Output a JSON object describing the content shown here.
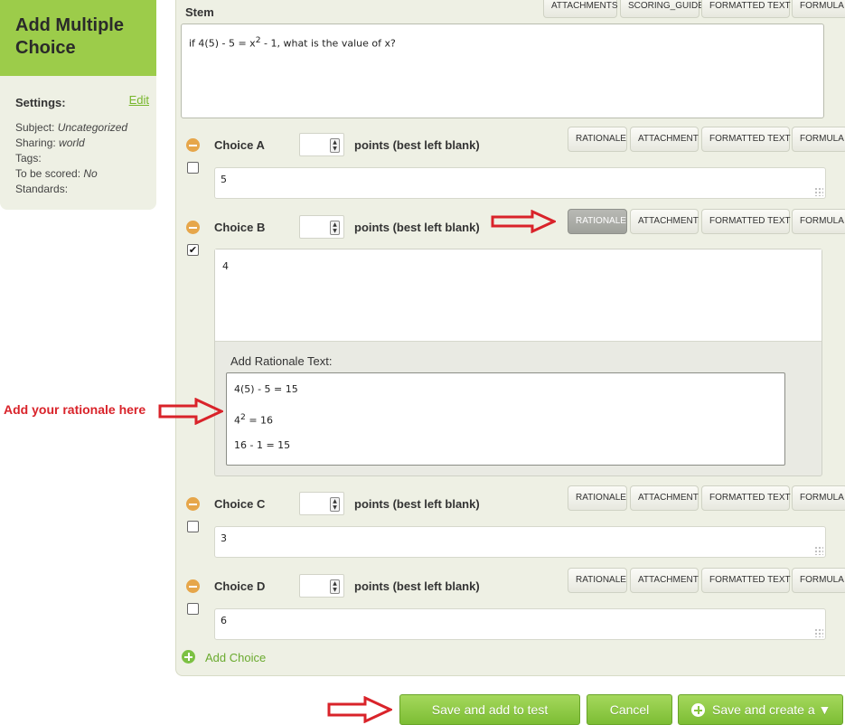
{
  "sidebar": {
    "title": "Add Multiple Choice",
    "settings_label": "Settings:",
    "edit_label": "Edit",
    "subject_label": "Subject:",
    "subject_value": "Uncategorized",
    "sharing_label": "Sharing:",
    "sharing_value": "world",
    "tags_label": "Tags:",
    "scored_label": "To be scored:",
    "scored_value": "No",
    "standards_label": "Standards:"
  },
  "stem": {
    "label": "Stem",
    "text_before": "if 4(5) - 5 = x",
    "text_sup": "2",
    "text_after": " - 1, what is the value of x?",
    "buttons": [
      "ATTACHMENTS",
      "SCORING_GUIDE",
      "FORMATTED TEXT",
      "FORMULA"
    ]
  },
  "choice_buttons": {
    "rationale": "RATIONALE",
    "attachment": "ATTACHMENT",
    "formatted_text": "FORMATTED TEXT",
    "formula": "FORMULA"
  },
  "points_label": "points (best left blank)",
  "choices": [
    {
      "label": "Choice A",
      "answer": "5",
      "checked": false
    },
    {
      "label": "Choice B",
      "answer": "4",
      "checked": true
    },
    {
      "label": "Choice C",
      "answer": "3",
      "checked": false
    },
    {
      "label": "Choice D",
      "answer": "6",
      "checked": false
    }
  ],
  "rationale": {
    "label": "Add Rationale Text:",
    "line1": "4(5) - 5 = 15",
    "line2_base": "4",
    "line2_sup": "2",
    "line2_rest": " = 16",
    "line3": "16 - 1 = 15"
  },
  "add_choice_label": "Add Choice",
  "footer": {
    "save_add": "Save and add to test",
    "cancel": "Cancel",
    "save_create": "Save and create a ▼"
  },
  "annotation": {
    "text": "Add your rationale here",
    "color": "#d9232a"
  },
  "colors": {
    "accent_green": "#9ccc4a",
    "panel_bg": "#eef0e4",
    "remove_icon": "#e6a64a"
  }
}
